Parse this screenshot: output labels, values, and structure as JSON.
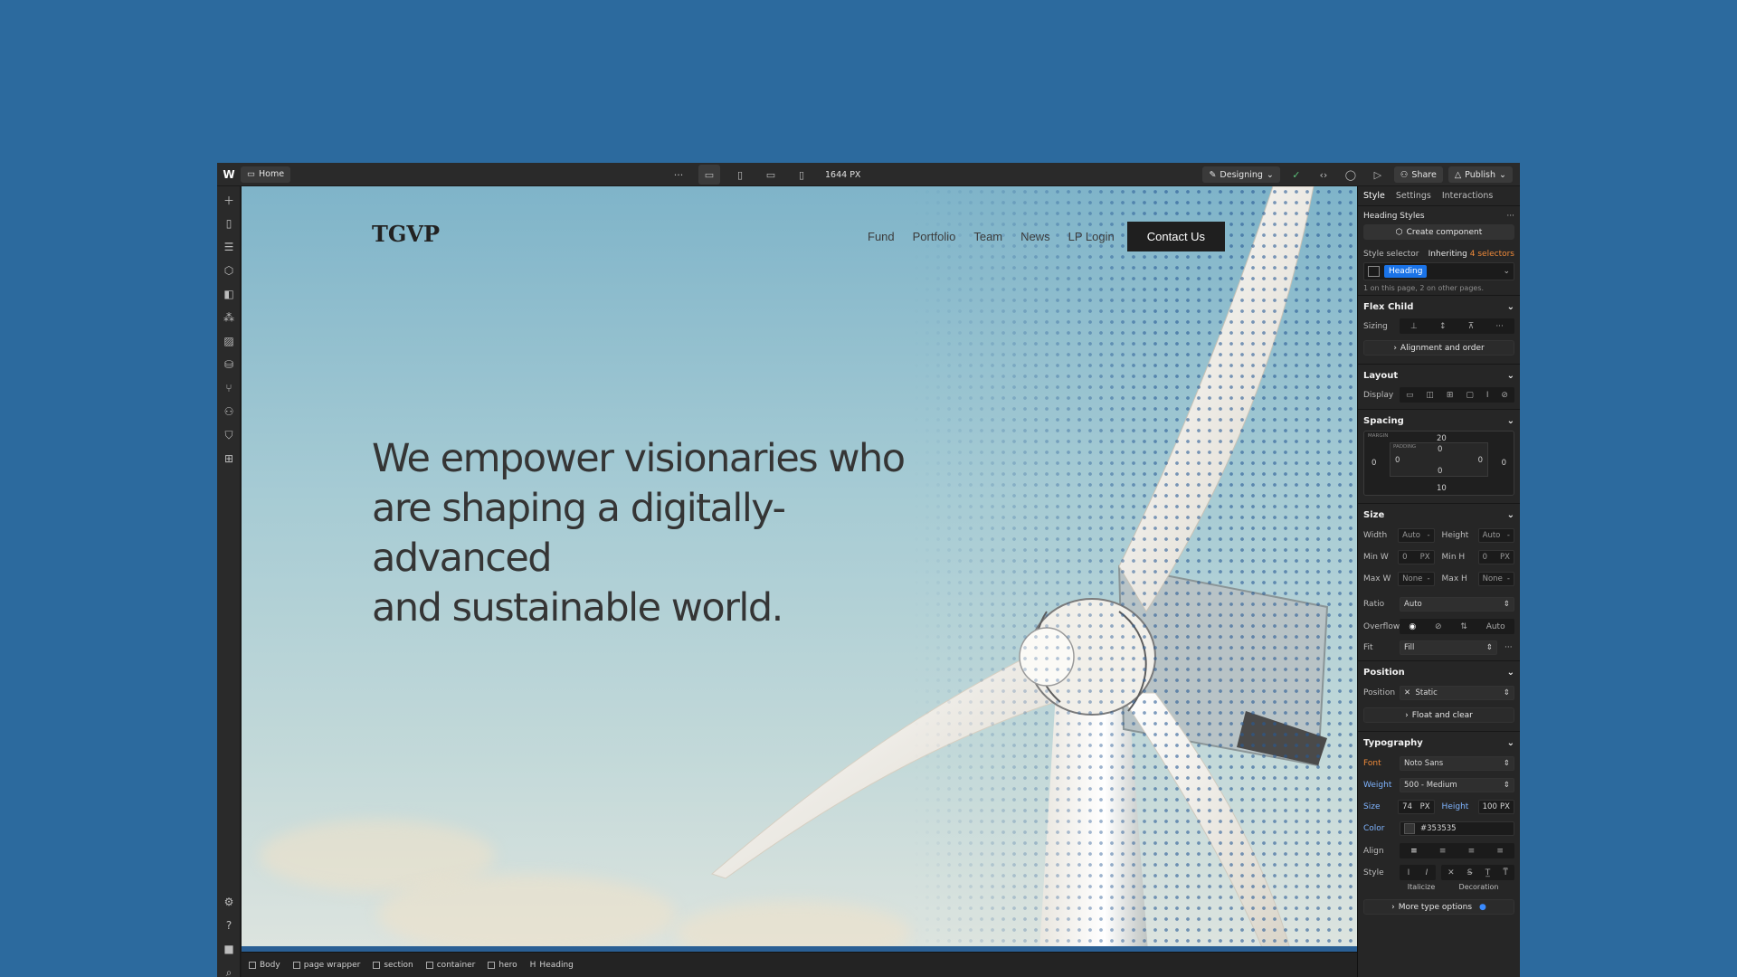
{
  "topbar": {
    "logo": "W",
    "page": "Home",
    "more": "···",
    "width_readout": "1644 PX",
    "mode": "Designing",
    "share": "Share",
    "publish": "Publish"
  },
  "site": {
    "logo": "TGVP",
    "nav": [
      "Fund",
      "Portfolio",
      "Team",
      "News",
      "LP Login"
    ],
    "cta": "Contact Us",
    "heading_lines": [
      "We empower visionaries who",
      "are shaping a digitally-advanced",
      "and sustainable world."
    ]
  },
  "breadcrumb": [
    "Body",
    "page wrapper",
    "section",
    "container",
    "hero",
    "Heading"
  ],
  "panel": {
    "tabs": [
      "Style",
      "Settings",
      "Interactions"
    ],
    "heading_styles": "Heading Styles",
    "create_component": "Create component",
    "style_selector": "Style selector",
    "inheriting": "Inheriting",
    "selectors_count": "4 selectors",
    "selector_tag": "Heading",
    "selector_note": "1 on this page, 2 on other pages.",
    "flex_child": "Flex Child",
    "sizing": "Sizing",
    "alignment": "Alignment and order",
    "layout": "Layout",
    "display": "Display",
    "spacing": "Spacing",
    "margin_caption": "MARGIN",
    "padding_caption": "PADDING",
    "margin": {
      "top": "20",
      "right": "0",
      "bottom": "10",
      "left": "0"
    },
    "padding": {
      "top": "0",
      "right": "0",
      "bottom": "0",
      "left": "0"
    },
    "size": "Size",
    "width_label": "Width",
    "width_value": "Auto",
    "height_label": "Height",
    "height_value": "Auto",
    "minw_label": "Min W",
    "minw_value": "0",
    "minh_label": "Min H",
    "minh_value": "0",
    "maxw_label": "Max W",
    "maxw_value": "None",
    "maxh_label": "Max H",
    "maxh_value": "None",
    "unit_px": "PX",
    "ratio_label": "Ratio",
    "ratio_value": "Auto",
    "overflow_label": "Overflow",
    "overflow_auto": "Auto",
    "fit_label": "Fit",
    "fit_value": "Fill",
    "position": "Position",
    "position_label": "Position",
    "position_value": "Static",
    "float_clear": "Float and clear",
    "typography": "Typography",
    "font_label": "Font",
    "font_value": "Noto Sans",
    "weight_label": "Weight",
    "weight_value": "500 - Medium",
    "size_label": "Size",
    "size_value": "74",
    "lh_label": "Height",
    "lh_value": "100",
    "color_label": "Color",
    "color_value": "#353535",
    "align_label": "Align",
    "style_label": "Style",
    "italicize": "Italicize",
    "decoration": "Decoration",
    "more_type": "More type options"
  },
  "colors": {
    "background": "#2c6a9e",
    "accent": "#1a73e8",
    "heading": "#353535"
  }
}
